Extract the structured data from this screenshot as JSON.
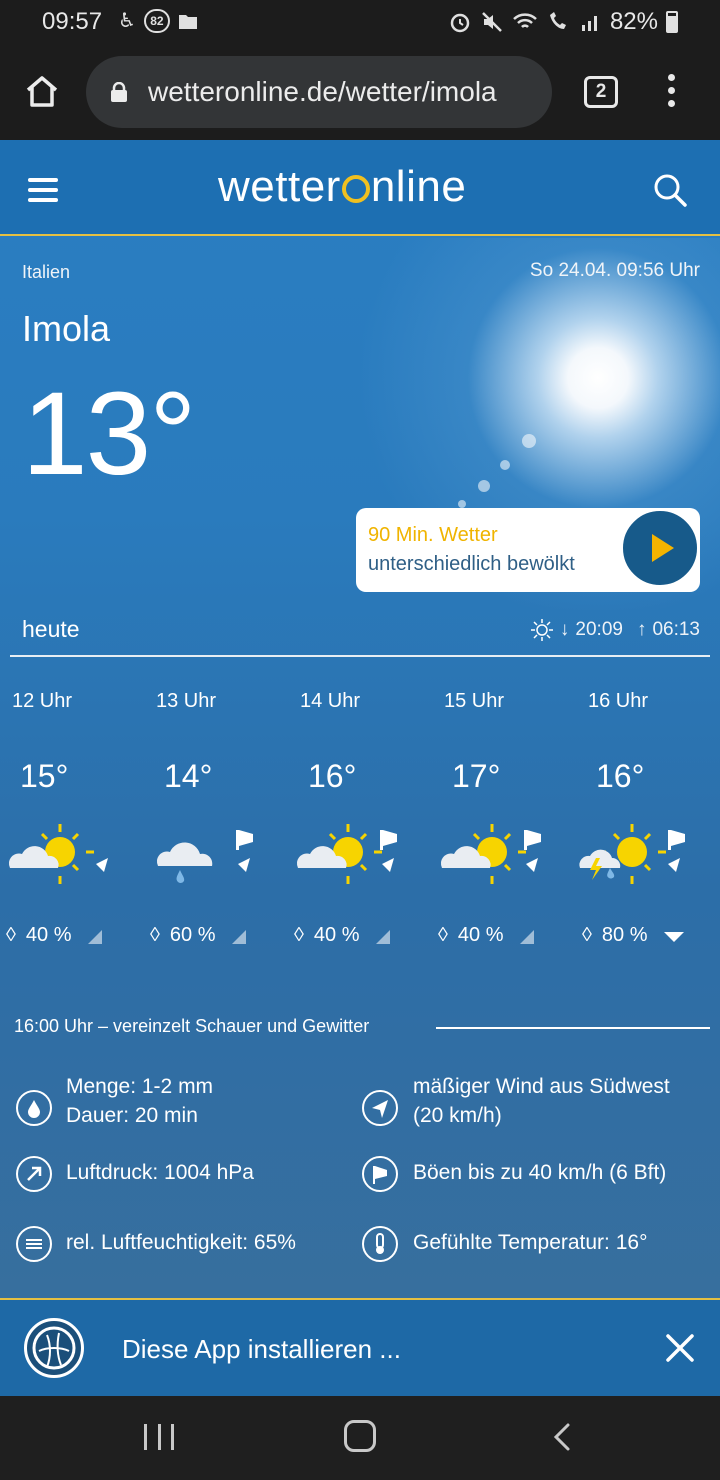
{
  "statusbar": {
    "time": "09:57",
    "badge": "82",
    "battery": "82%"
  },
  "browser": {
    "url": "wetteronline.de/wetter/imola",
    "tab_count": "2"
  },
  "header": {
    "logo_left": "wetter",
    "logo_right": "nline"
  },
  "hero": {
    "country": "Italien",
    "datetime": "So 24.04. 09:56 Uhr",
    "city": "Imola",
    "temperature": "13°"
  },
  "nowcast": {
    "title": "90 Min. Wetter",
    "subtitle": "unterschiedlich bewölkt"
  },
  "today": {
    "label": "heute",
    "sunset": "20:09",
    "sunrise": "06:13"
  },
  "hours": [
    {
      "label": "12 Uhr",
      "temp": "15°",
      "rain": "40 %",
      "icon": "sun-cloud-icon"
    },
    {
      "label": "13 Uhr",
      "temp": "14°",
      "rain": "60 %",
      "icon": "cloud-rain-icon"
    },
    {
      "label": "14 Uhr",
      "temp": "16°",
      "rain": "40 %",
      "icon": "sun-cloud-icon"
    },
    {
      "label": "15 Uhr",
      "temp": "17°",
      "rain": "40 %",
      "icon": "sun-cloud-icon"
    },
    {
      "label": "16 Uhr",
      "temp": "16°",
      "rain": "80 %",
      "icon": "sun-cloud-thunder-icon"
    }
  ],
  "details": {
    "title": "16:00 Uhr – vereinzelt Schauer und Gewitter",
    "precip_amount": "Menge: 1-2 mm",
    "precip_duration": "Dauer: 20 min",
    "wind": "mäßiger Wind aus Südwest",
    "wind_speed": "(20 km/h)",
    "pressure": "Luftdruck: 1004 hPa",
    "gusts": "Böen bis zu 40 km/h (6 Bft)",
    "humidity": "rel. Luftfeuchtigkeit: 65%",
    "feels_like": "Gefühlte Temperatur: 16°"
  },
  "install": {
    "text": "Diese App installieren ..."
  }
}
